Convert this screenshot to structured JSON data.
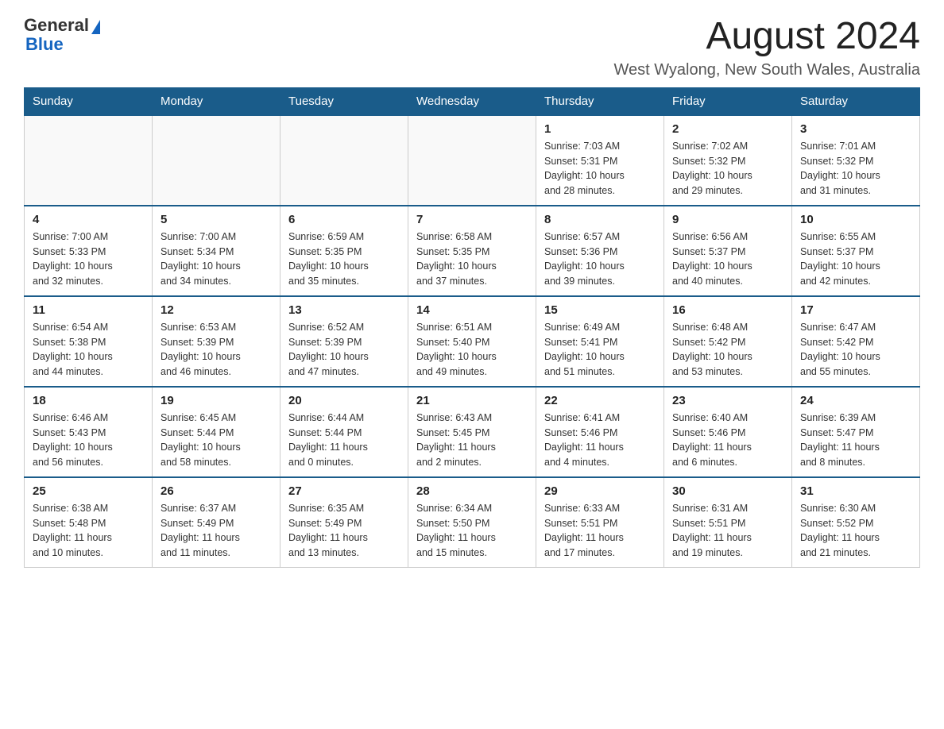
{
  "header": {
    "logo_text_general": "General",
    "logo_text_blue": "Blue",
    "month_title": "August 2024",
    "location": "West Wyalong, New South Wales, Australia"
  },
  "weekdays": [
    "Sunday",
    "Monday",
    "Tuesday",
    "Wednesday",
    "Thursday",
    "Friday",
    "Saturday"
  ],
  "weeks": [
    [
      {
        "day": "",
        "info": ""
      },
      {
        "day": "",
        "info": ""
      },
      {
        "day": "",
        "info": ""
      },
      {
        "day": "",
        "info": ""
      },
      {
        "day": "1",
        "info": "Sunrise: 7:03 AM\nSunset: 5:31 PM\nDaylight: 10 hours\nand 28 minutes."
      },
      {
        "day": "2",
        "info": "Sunrise: 7:02 AM\nSunset: 5:32 PM\nDaylight: 10 hours\nand 29 minutes."
      },
      {
        "day": "3",
        "info": "Sunrise: 7:01 AM\nSunset: 5:32 PM\nDaylight: 10 hours\nand 31 minutes."
      }
    ],
    [
      {
        "day": "4",
        "info": "Sunrise: 7:00 AM\nSunset: 5:33 PM\nDaylight: 10 hours\nand 32 minutes."
      },
      {
        "day": "5",
        "info": "Sunrise: 7:00 AM\nSunset: 5:34 PM\nDaylight: 10 hours\nand 34 minutes."
      },
      {
        "day": "6",
        "info": "Sunrise: 6:59 AM\nSunset: 5:35 PM\nDaylight: 10 hours\nand 35 minutes."
      },
      {
        "day": "7",
        "info": "Sunrise: 6:58 AM\nSunset: 5:35 PM\nDaylight: 10 hours\nand 37 minutes."
      },
      {
        "day": "8",
        "info": "Sunrise: 6:57 AM\nSunset: 5:36 PM\nDaylight: 10 hours\nand 39 minutes."
      },
      {
        "day": "9",
        "info": "Sunrise: 6:56 AM\nSunset: 5:37 PM\nDaylight: 10 hours\nand 40 minutes."
      },
      {
        "day": "10",
        "info": "Sunrise: 6:55 AM\nSunset: 5:37 PM\nDaylight: 10 hours\nand 42 minutes."
      }
    ],
    [
      {
        "day": "11",
        "info": "Sunrise: 6:54 AM\nSunset: 5:38 PM\nDaylight: 10 hours\nand 44 minutes."
      },
      {
        "day": "12",
        "info": "Sunrise: 6:53 AM\nSunset: 5:39 PM\nDaylight: 10 hours\nand 46 minutes."
      },
      {
        "day": "13",
        "info": "Sunrise: 6:52 AM\nSunset: 5:39 PM\nDaylight: 10 hours\nand 47 minutes."
      },
      {
        "day": "14",
        "info": "Sunrise: 6:51 AM\nSunset: 5:40 PM\nDaylight: 10 hours\nand 49 minutes."
      },
      {
        "day": "15",
        "info": "Sunrise: 6:49 AM\nSunset: 5:41 PM\nDaylight: 10 hours\nand 51 minutes."
      },
      {
        "day": "16",
        "info": "Sunrise: 6:48 AM\nSunset: 5:42 PM\nDaylight: 10 hours\nand 53 minutes."
      },
      {
        "day": "17",
        "info": "Sunrise: 6:47 AM\nSunset: 5:42 PM\nDaylight: 10 hours\nand 55 minutes."
      }
    ],
    [
      {
        "day": "18",
        "info": "Sunrise: 6:46 AM\nSunset: 5:43 PM\nDaylight: 10 hours\nand 56 minutes."
      },
      {
        "day": "19",
        "info": "Sunrise: 6:45 AM\nSunset: 5:44 PM\nDaylight: 10 hours\nand 58 minutes."
      },
      {
        "day": "20",
        "info": "Sunrise: 6:44 AM\nSunset: 5:44 PM\nDaylight: 11 hours\nand 0 minutes."
      },
      {
        "day": "21",
        "info": "Sunrise: 6:43 AM\nSunset: 5:45 PM\nDaylight: 11 hours\nand 2 minutes."
      },
      {
        "day": "22",
        "info": "Sunrise: 6:41 AM\nSunset: 5:46 PM\nDaylight: 11 hours\nand 4 minutes."
      },
      {
        "day": "23",
        "info": "Sunrise: 6:40 AM\nSunset: 5:46 PM\nDaylight: 11 hours\nand 6 minutes."
      },
      {
        "day": "24",
        "info": "Sunrise: 6:39 AM\nSunset: 5:47 PM\nDaylight: 11 hours\nand 8 minutes."
      }
    ],
    [
      {
        "day": "25",
        "info": "Sunrise: 6:38 AM\nSunset: 5:48 PM\nDaylight: 11 hours\nand 10 minutes."
      },
      {
        "day": "26",
        "info": "Sunrise: 6:37 AM\nSunset: 5:49 PM\nDaylight: 11 hours\nand 11 minutes."
      },
      {
        "day": "27",
        "info": "Sunrise: 6:35 AM\nSunset: 5:49 PM\nDaylight: 11 hours\nand 13 minutes."
      },
      {
        "day": "28",
        "info": "Sunrise: 6:34 AM\nSunset: 5:50 PM\nDaylight: 11 hours\nand 15 minutes."
      },
      {
        "day": "29",
        "info": "Sunrise: 6:33 AM\nSunset: 5:51 PM\nDaylight: 11 hours\nand 17 minutes."
      },
      {
        "day": "30",
        "info": "Sunrise: 6:31 AM\nSunset: 5:51 PM\nDaylight: 11 hours\nand 19 minutes."
      },
      {
        "day": "31",
        "info": "Sunrise: 6:30 AM\nSunset: 5:52 PM\nDaylight: 11 hours\nand 21 minutes."
      }
    ]
  ]
}
